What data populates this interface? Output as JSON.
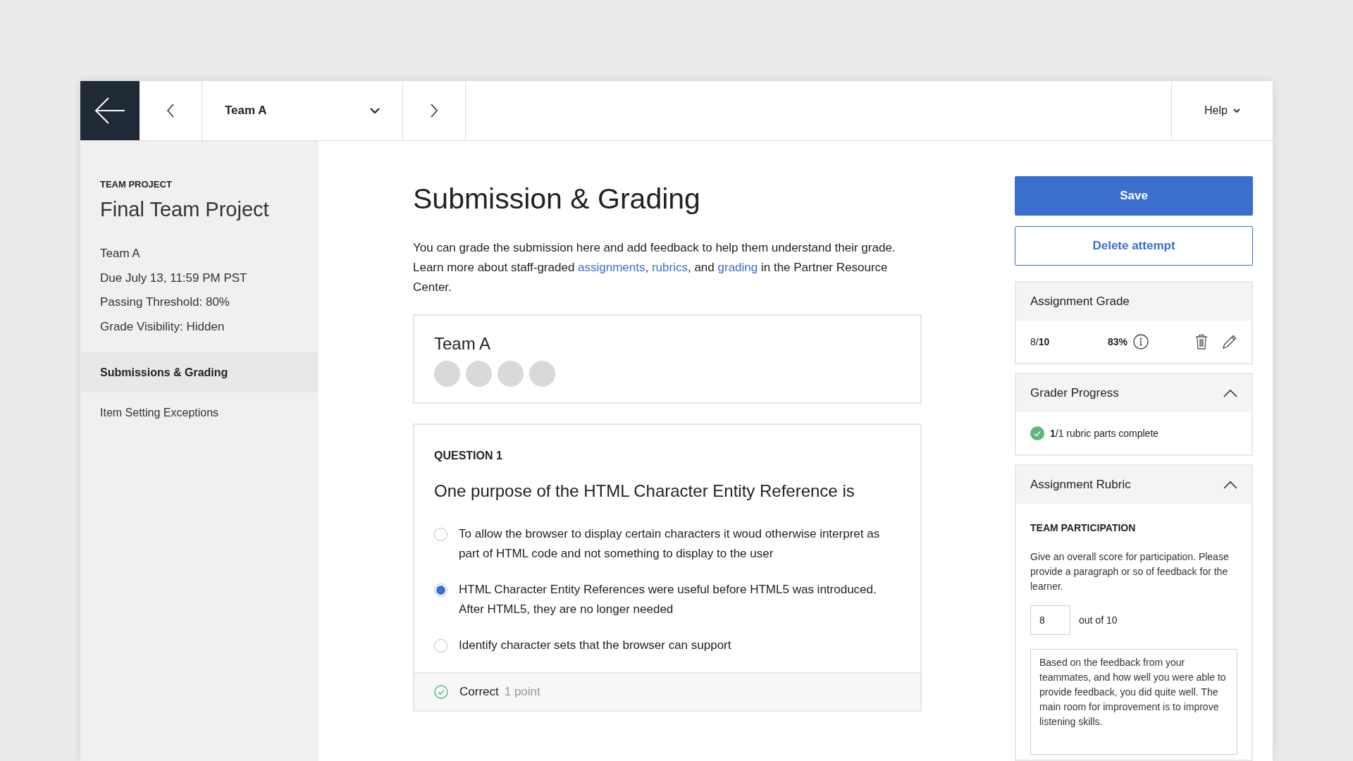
{
  "top_bar": {
    "team_selector": "Team A",
    "help": "Help"
  },
  "sidebar": {
    "eyebrow": "TEAM PROJECT",
    "title": "Final Team Project",
    "details": [
      "Team A",
      "Due July 13, 11:59 PM PST",
      "Passing Threshold: 80%",
      "Grade Visibility: Hidden"
    ],
    "items": [
      {
        "label": "Submissions & Grading",
        "selected": true
      },
      {
        "label": "Item Setting Exceptions",
        "selected": false
      }
    ]
  },
  "main": {
    "heading": "Submission & Grading",
    "intro": [
      {
        "kind": "text",
        "text": "You can grade the submission here and add feedback to help them understand their grade. Learn more about staff-graded "
      },
      {
        "kind": "link",
        "text": "assignments"
      },
      {
        "kind": "text",
        "text": ", "
      },
      {
        "kind": "link",
        "text": "rubrics"
      },
      {
        "kind": "text",
        "text": ", and "
      },
      {
        "kind": "link",
        "text": "grading"
      },
      {
        "kind": "text",
        "text": " in the Partner Resource Center."
      }
    ],
    "team": {
      "name": "Team A",
      "avatars": [
        {
          "kind": "placeholder"
        },
        {
          "kind": "placeholder"
        },
        {
          "kind": "placeholder"
        },
        {
          "kind": "placeholder"
        }
      ]
    },
    "question": {
      "label": "QUESTION 1",
      "prompt": "One purpose of the HTML Character Entity Reference is",
      "options": [
        {
          "text": "To allow the browser to display certain characters it woud otherwise interpret as part of HTML code and not something to display to the user",
          "selected": false
        },
        {
          "text": "HTML Character Entity References were useful before HTML5 was introduced. After HTML5, they are no longer needed",
          "selected": true
        },
        {
          "text": "Identify character sets that the browser can support",
          "selected": false
        }
      ],
      "result": {
        "correct": true,
        "status": "Correct",
        "points": "1 point"
      }
    }
  },
  "grading": {
    "save": "Save",
    "delete": "Delete attempt",
    "assignment_grade": {
      "title": "Assignment Grade",
      "score": "8/**10**",
      "percent": "83%"
    },
    "grader_progress": {
      "title": "Grader Progress",
      "expanded": true,
      "status": "**1**/1 rubric parts complete"
    },
    "rubric": {
      "title": "Assignment Rubric",
      "expanded": true,
      "criterion": "TEAM PARTICIPATION",
      "description": "Give an overall score for participation. Please provide a paragraph or so of feedback for the learner.",
      "score": "8",
      "out_of": "out of 10",
      "feedback": "Based on the feedback from your teammates, and how well you were able to provide feedback, you did quite well. The main room for improvement is to improve listening skills."
    }
  }
}
